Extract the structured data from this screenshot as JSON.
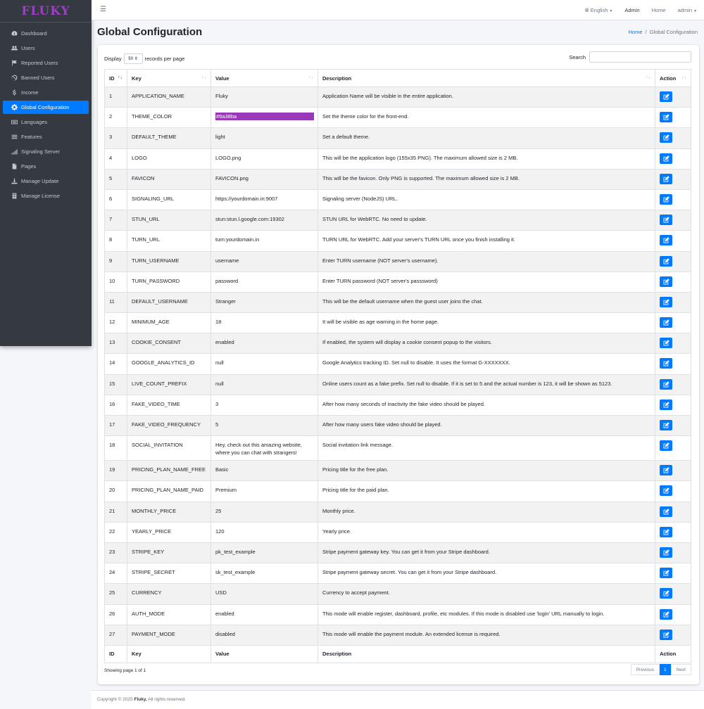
{
  "brand": "FLUKY",
  "sidebar": {
    "items": [
      {
        "label": "Dashboard",
        "icon": "dashboard-icon"
      },
      {
        "label": "Users",
        "icon": "users-icon"
      },
      {
        "label": "Reported Users",
        "icon": "flag-icon"
      },
      {
        "label": "Banned Users",
        "icon": "ban-icon"
      },
      {
        "label": "Income",
        "icon": "dollar-icon"
      },
      {
        "label": "Global Configuration",
        "icon": "gear-icon",
        "active": true
      },
      {
        "label": "Languages",
        "icon": "language-icon"
      },
      {
        "label": "Features",
        "icon": "list-icon"
      },
      {
        "label": "Signaling Server",
        "icon": "signal-icon"
      },
      {
        "label": "Pages",
        "icon": "pages-icon"
      },
      {
        "label": "Manage Update",
        "icon": "download-icon"
      },
      {
        "label": "Manage License",
        "icon": "license-icon"
      }
    ]
  },
  "topbar": {
    "language": "English",
    "admin_link": "Admin",
    "home_link": "Home",
    "user": "admin"
  },
  "page": {
    "title": "Global Configuration",
    "breadcrumb_home": "Home",
    "breadcrumb_current": "Global Configuration"
  },
  "table_tools": {
    "display_label": "Display",
    "per_page": "50",
    "records_label": "records per page",
    "search_label": "Search"
  },
  "table": {
    "headers": [
      "ID",
      "Key",
      "Value",
      "Description",
      "Action"
    ],
    "rows": [
      [
        "1",
        "APPLICATION_NAME",
        "Fluky",
        "Application Name will be visible in the entire application."
      ],
      [
        "2",
        "THEME_COLOR",
        "#9a38ba",
        "Set the theme color for the front-end."
      ],
      [
        "3",
        "DEFAULT_THEME",
        "light",
        "Set a default theme."
      ],
      [
        "4",
        "LOGO",
        "LOGO.png",
        "This will be the application logo (155x35 PNG). The maximum allowed size is 2 MB."
      ],
      [
        "5",
        "FAVICON",
        "FAVICON.png",
        "This will be the favicon. Only PNG is supported. The maximum allowed size is 2 MB."
      ],
      [
        "6",
        "SIGNALING_URL",
        "https://yourdomain.in:9007",
        "Signaling server (NodeJS) URL."
      ],
      [
        "7",
        "STUN_URL",
        "stun:stun.l.google.com:19302",
        "STUN URL for WebRTC. No need to update."
      ],
      [
        "8",
        "TURN_URL",
        "turn:yourdomain.in",
        "TURN URL for WebRTC. Add your server's TURN URL once you finish installing it."
      ],
      [
        "9",
        "TURN_USERNAME",
        "username",
        "Enter TURN username (NOT server's username)."
      ],
      [
        "10",
        "TURN_PASSWORD",
        "password",
        "Enter TURN password (NOT server's passsword)"
      ],
      [
        "11",
        "DEFAULT_USERNAME",
        "Stranger",
        "This will be the default username when the guest user joins the chat."
      ],
      [
        "12",
        "MINIMUM_AGE",
        "18",
        "It will be visible as age warning in the home page."
      ],
      [
        "13",
        "COOKIE_CONSENT",
        "enabled",
        "If enabled, the system will display a cookie consent popup to the visitors."
      ],
      [
        "14",
        "GOOGLE_ANALYTICS_ID",
        "null",
        "Google Analytics tracking ID. Set null to disable. It uses the format G-XXXXXXX."
      ],
      [
        "15",
        "LIVE_COUNT_PREFIX",
        "null",
        "Online users count as a fake prefix. Set null to disable. If it is set to 5 and the actual number is 123, it will be shown as 5123."
      ],
      [
        "16",
        "FAKE_VIDEO_TIME",
        "3",
        "After how many seconds of inactivity the fake video should be played."
      ],
      [
        "17",
        "FAKE_VIDEO_FREQUENCY",
        "5",
        "After how many users fake video should be played."
      ],
      [
        "18",
        "SOCIAL_INVITATION",
        "Hey, check out this amazing website, where you can chat with strangers!",
        "Social invitation link message."
      ],
      [
        "19",
        "PRICING_PLAN_NAME_FREE",
        "Basic",
        "Pricing title for the free plan."
      ],
      [
        "20",
        "PRICING_PLAN_NAME_PAID",
        "Premium",
        "Pricing title for the paid plan."
      ],
      [
        "21",
        "MONTHLY_PRICE",
        "25",
        "Monthly price."
      ],
      [
        "22",
        "YEARLY_PRICE",
        "120",
        "Yearly price."
      ],
      [
        "23",
        "STRIPE_KEY",
        "pk_test_example",
        "Stripe payment gateway key. You can get it from your Stripe dashboard."
      ],
      [
        "24",
        "STRIPE_SECRET",
        "sk_test_example",
        "Stripe payment gateway secret. You can get it from your Stripe dashboard."
      ],
      [
        "25",
        "CURRENCY",
        "USD",
        "Currency to accept payment."
      ],
      [
        "26",
        "AUTH_MODE",
        "enabled",
        "This mode will enable register, dashboard, profile, etc modules. If this mode is disabled use 'login' URL manually to login."
      ],
      [
        "27",
        "PAYMENT_MODE",
        "disabled",
        "This mode will enable the payment module. An extended license is required."
      ]
    ]
  },
  "pagination": {
    "info": "Showing page 1 of 1",
    "previous": "Previous",
    "current": "1",
    "next": "Next"
  },
  "footer": {
    "prefix": "Copyright © 2025",
    "brand": "Fluky.",
    "suffix": "All rights reserved."
  },
  "colors": {
    "accent": "#007bff",
    "sidebar": "#343a40",
    "theme": "#9a38ba"
  }
}
